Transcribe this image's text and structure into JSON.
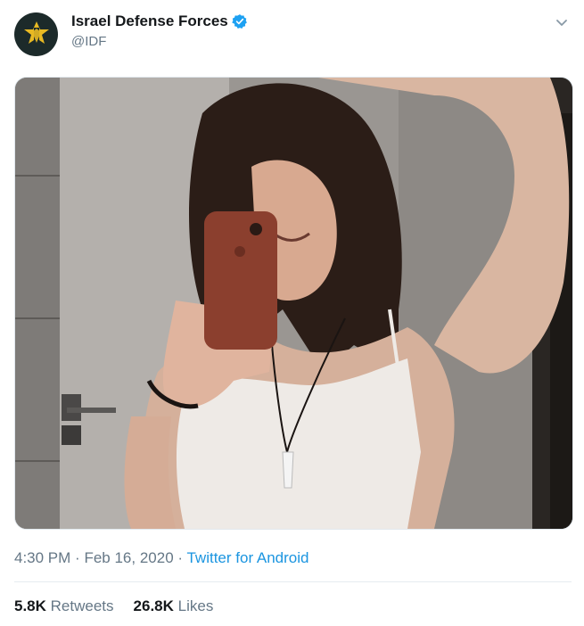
{
  "tweet": {
    "author": {
      "display_name": "Israel Defense Forces",
      "handle": "@IDF",
      "avatar_icon": "idf-emblem-icon",
      "verified_icon": "verified-badge-icon"
    },
    "media": {
      "description_icon": "photo"
    },
    "time": "4:30 PM",
    "separator": "·",
    "date": "Feb 16, 2020",
    "source": "Twitter for Android",
    "stats": {
      "retweets_count": "5.8K",
      "retweets_label": "Retweets",
      "likes_count": "26.8K",
      "likes_label": "Likes"
    }
  },
  "colors": {
    "link": "#1b95e0",
    "verified": "#1da1f2",
    "muted": "#657786",
    "text": "#14171a"
  }
}
